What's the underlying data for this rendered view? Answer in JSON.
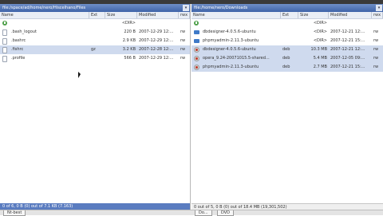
{
  "left": {
    "path": "file:/space/ad/home/nero/Hiscelhano/Files",
    "columns": [
      "Name",
      "Ext",
      "Size",
      "Modified",
      "rwx"
    ],
    "rows": [
      {
        "icon": "up-icon",
        "name": "",
        "ext": "",
        "size": "<DIR>",
        "modified": "",
        "attr": ""
      },
      {
        "icon": "file-icon",
        "name": ".bash_logout",
        "ext": "",
        "size": "220 B",
        "modified": "2007-12-29 12:...",
        "attr": "rw"
      },
      {
        "icon": "file-icon",
        "name": ".bashrc",
        "ext": "",
        "size": "2.9 KB",
        "modified": "2007-12-29 12:...",
        "attr": "rw"
      },
      {
        "icon": "file-icon",
        "name": ".fishrc",
        "ext": "gz",
        "size": "3.2 KB",
        "modified": "2007-12-28 12:...",
        "attr": "rw"
      },
      {
        "icon": "file-icon",
        "name": ".profile",
        "ext": "",
        "size": "566 B",
        "modified": "2007-12-29 12:...",
        "attr": "rw"
      }
    ],
    "status": "0 of 6, 0 B (0) out of 7.1 KB (7.163)"
  },
  "right": {
    "path": "file:/home/nero/Downloads",
    "columns": [
      "Name",
      "Ext",
      "Size",
      "Modified",
      "rwx"
    ],
    "rows": [
      {
        "icon": "up-icon",
        "name": "",
        "ext": "",
        "size": "<DIR>",
        "modified": "",
        "attr": ""
      },
      {
        "icon": "folder-icon",
        "name": "dbdesigner-4.0.5.6-ubuntu",
        "ext": "",
        "size": "<DIR>",
        "modified": "2007-12-21 12:...",
        "attr": "rw"
      },
      {
        "icon": "folder-icon",
        "name": "phpmyadmin-2.11.3-ubuntu",
        "ext": "",
        "size": "<DIR>",
        "modified": "2007-12-21 15:...",
        "attr": "rw"
      },
      {
        "icon": "deb-icon",
        "name": "dbdesigner-4.0.5.6-ubuntu",
        "ext": "deb",
        "size": "10.3 MB",
        "modified": "2007-12-21 12:...",
        "attr": "rw"
      },
      {
        "icon": "deb-icon",
        "name": "opera_9.24-20071015.5-shared...",
        "ext": "deb",
        "size": "5.4 MB",
        "modified": "2007-12-05 09:...",
        "attr": "rw"
      },
      {
        "icon": "deb-icon",
        "name": "phpmyadmin-2.11.3-ubuntu",
        "ext": "deb",
        "size": "2.7 MB",
        "modified": "2007-12-21 15:...",
        "attr": "rw"
      }
    ],
    "status": "0 out of 5, 0 B (0) out of 18.4 MB (19,301,502)"
  },
  "bottom": {
    "left_tab": "Nt-best",
    "right_tabs": [
      "Do...",
      "DVD"
    ]
  }
}
